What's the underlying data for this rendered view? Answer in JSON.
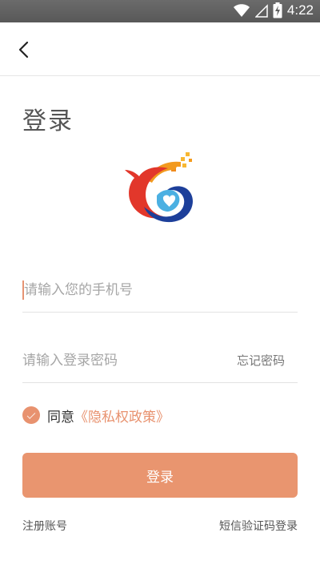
{
  "status_bar": {
    "time": "4:22",
    "icons": [
      "wifi-icon",
      "signal-icon",
      "battery-charging-icon"
    ]
  },
  "navbar": {
    "back_icon": "chevron-left-icon"
  },
  "page_title": "登录",
  "logo": {
    "colors": [
      "#e53b2c",
      "#f59a1b",
      "#1d3f9a",
      "#4bb0e2"
    ]
  },
  "form": {
    "phone_placeholder": "请输入您的手机号",
    "phone_value": "",
    "password_placeholder": "请输入登录密码",
    "password_value": "",
    "forgot_password": "忘记密码"
  },
  "agreement": {
    "label": "同意",
    "policy_link": "《隐私权政策》",
    "checked": true
  },
  "login_button": "登录",
  "footer": {
    "register": "注册账号",
    "sms_login": "短信验证码登录"
  },
  "colors": {
    "accent": "#e9956f",
    "status_bar": "#5f5f5f",
    "placeholder": "#a6a6a6"
  }
}
